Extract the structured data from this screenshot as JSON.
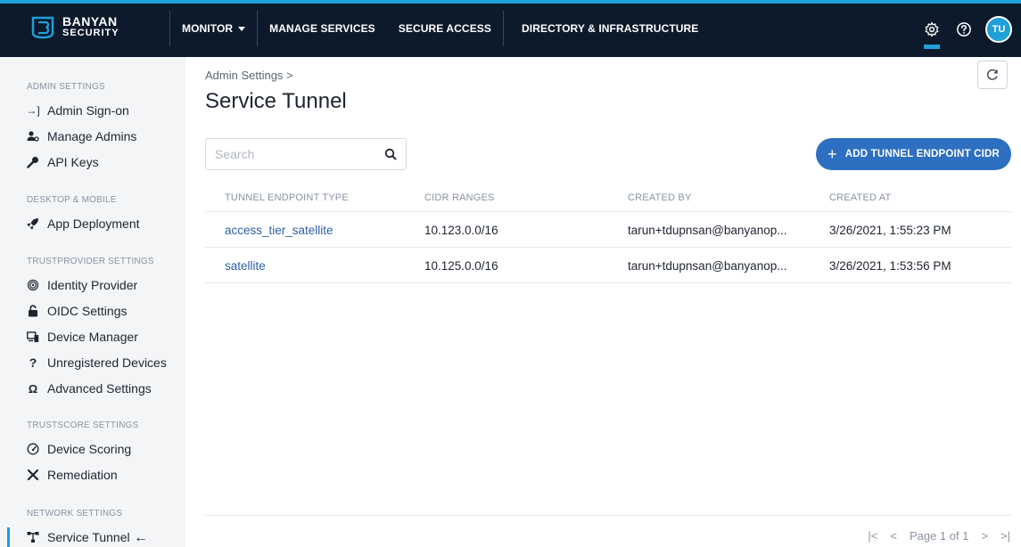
{
  "brand": {
    "line1": "BANYAN",
    "line2": "SECURITY"
  },
  "nav": {
    "items": [
      {
        "label": "MONITOR",
        "has_caret": true
      },
      {
        "label": "MANAGE SERVICES"
      },
      {
        "label": "SECURE ACCESS"
      },
      {
        "label": "DIRECTORY & INFRASTRUCTURE"
      }
    ]
  },
  "topright": {
    "avatar_initials": "TU",
    "icons": [
      "gear-icon",
      "help-icon"
    ]
  },
  "sidebar": {
    "sections": [
      {
        "title": "ADMIN SETTINGS",
        "items": [
          {
            "label": "Admin Sign-on",
            "icon": "sign-in-icon"
          },
          {
            "label": "Manage Admins",
            "icon": "admins-icon"
          },
          {
            "label": "API Keys",
            "icon": "key-icon"
          }
        ]
      },
      {
        "title": "DESKTOP & MOBILE",
        "items": [
          {
            "label": "App Deployment",
            "icon": "rocket-icon"
          }
        ]
      },
      {
        "title": "TRUSTPROVIDER SETTINGS",
        "items": [
          {
            "label": "Identity Provider",
            "icon": "fingerprint-icon"
          },
          {
            "label": "OIDC Settings",
            "icon": "lock-icon"
          },
          {
            "label": "Device Manager",
            "icon": "devices-icon"
          },
          {
            "label": "Unregistered Devices",
            "icon": "question-icon"
          },
          {
            "label": "Advanced Settings",
            "icon": "omega-icon"
          }
        ]
      },
      {
        "title": "TRUSTSCORE SETTINGS",
        "items": [
          {
            "label": "Device Scoring",
            "icon": "gauge-icon"
          },
          {
            "label": "Remediation",
            "icon": "tools-icon"
          }
        ]
      },
      {
        "title": "NETWORK SETTINGS",
        "items": [
          {
            "label": "Service Tunnel",
            "icon": "network-icon",
            "active": true
          }
        ]
      }
    ]
  },
  "main": {
    "breadcrumb": "Admin Settings >",
    "title": "Service Tunnel",
    "search_placeholder": "Search",
    "add_button": "ADD TUNNEL ENDPOINT CIDR",
    "table": {
      "headers": [
        "TUNNEL ENDPOINT TYPE",
        "CIDR RANGES",
        "CREATED BY",
        "CREATED AT"
      ],
      "rows": [
        [
          "access_tier_satellite",
          "10.123.0.0/16",
          "tarun+tdupnsan@banyanop...",
          "3/26/2021, 1:55:23 PM"
        ],
        [
          "satellite",
          "10.125.0.0/16",
          "tarun+tdupnsan@banyanop...",
          "3/26/2021, 1:53:56 PM"
        ]
      ]
    },
    "pager": {
      "first": "|<",
      "prev": "<",
      "label": "Page 1 of 1",
      "next": ">",
      "last": ">|"
    }
  },
  "colors": {
    "topbar": "#0c1a2b",
    "accent": "#1fa0d8",
    "primary_button": "#2d6fc0",
    "link": "#2d5fa8"
  }
}
